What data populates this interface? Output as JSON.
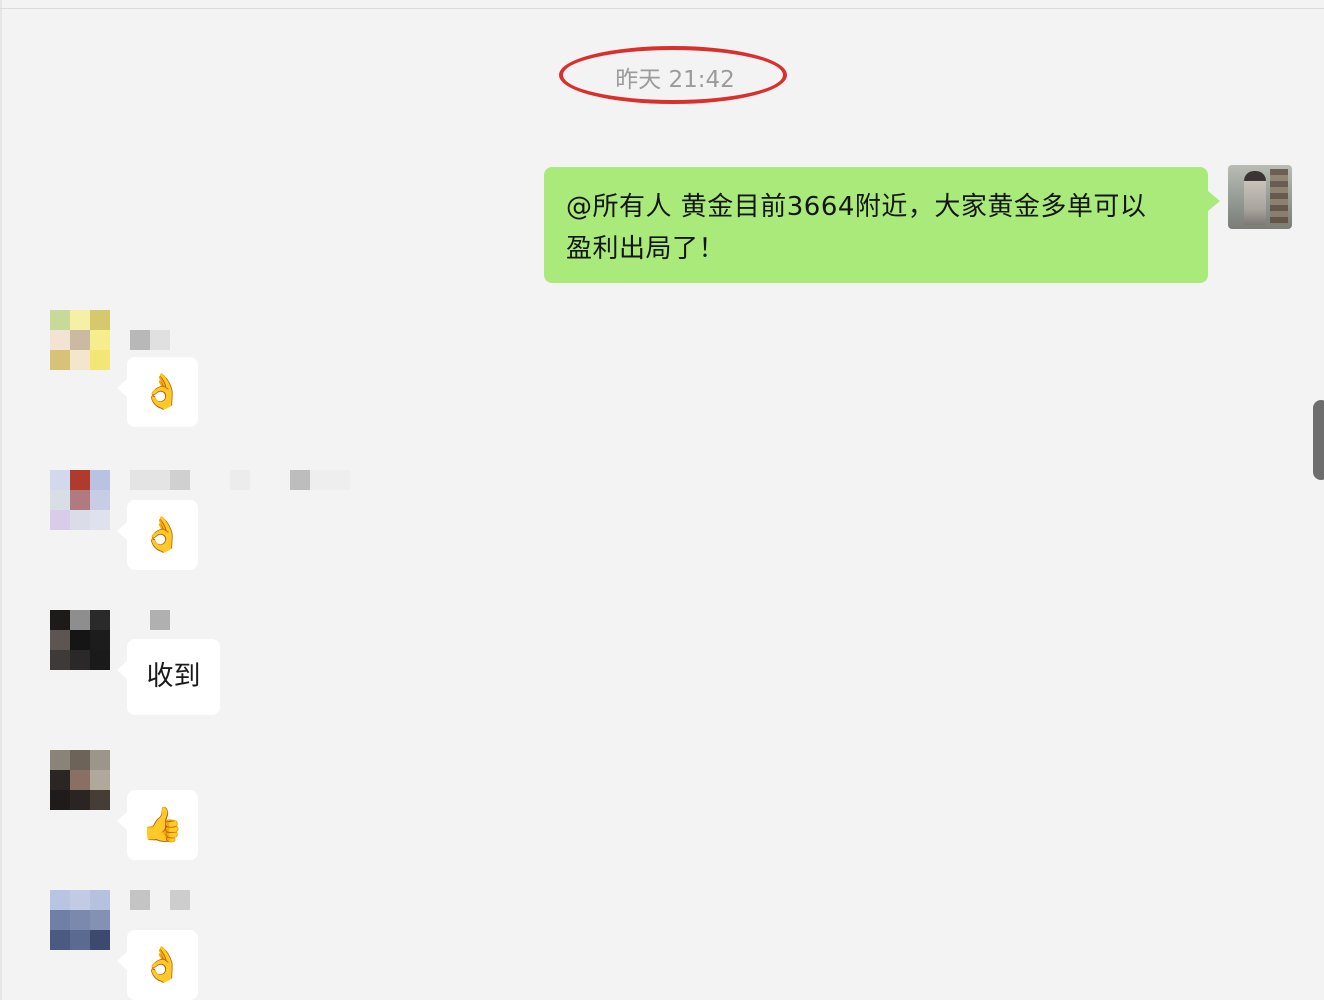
{
  "timestamp": "昨天 21:42",
  "outgoing_message": {
    "line1": "@所有人 黄金目前3664附近，大家黄金多单可以",
    "line2": "盈利出局了！"
  },
  "incoming_messages": [
    {
      "content": "👌",
      "kind": "emoji"
    },
    {
      "content": "👌",
      "kind": "emoji"
    },
    {
      "content": "收到",
      "kind": "text"
    },
    {
      "content": "👍",
      "kind": "emoji"
    },
    {
      "content": "👌",
      "kind": "emoji"
    }
  ],
  "colors": {
    "outgoing_bubble": "#a9ea7a",
    "incoming_bubble": "#ffffff",
    "background": "#f3f3f3",
    "highlight_circle": "#d9302c"
  }
}
